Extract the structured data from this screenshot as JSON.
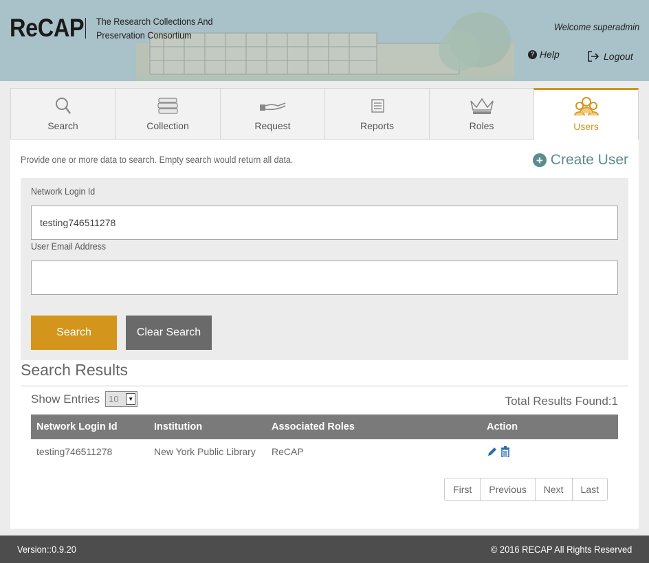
{
  "header": {
    "logo": "ReCAP",
    "tagline_line1": "The Research Collections And",
    "tagline_line2": "Preservation Consortium",
    "welcome": "Welcome superadmin",
    "help_label": "Help",
    "logout_label": "Logout"
  },
  "tabs": [
    {
      "label": "Search",
      "icon": "search-icon"
    },
    {
      "label": "Collection",
      "icon": "books-icon"
    },
    {
      "label": "Request",
      "icon": "hand-book-icon"
    },
    {
      "label": "Reports",
      "icon": "report-icon"
    },
    {
      "label": "Roles",
      "icon": "crown-icon"
    },
    {
      "label": "Users",
      "icon": "users-icon",
      "active": true
    }
  ],
  "main": {
    "hint": "Provide one or more data to search. Empty search would return all data.",
    "create_user": "Create User",
    "network_login_label": "Network Login Id",
    "network_login_value": "testing746511278",
    "email_label": "User Email Address",
    "email_value": "",
    "search_button": "Search",
    "clear_button": "Clear Search"
  },
  "results": {
    "title": "Search Results",
    "show_entries_label": "Show Entries",
    "entries_value": "10",
    "total_label": "Total Results Found:1",
    "columns": [
      "Network Login Id",
      "Institution",
      "Associated Roles",
      "Action"
    ],
    "rows": [
      {
        "login": "testing746511278",
        "institution": "New York Public Library",
        "roles": "ReCAP"
      }
    ],
    "pager": [
      "First",
      "Previous",
      "Next",
      "Last"
    ]
  },
  "footer": {
    "version": "Version::0.9.20",
    "copyright": "© 2016 RECAP All Rights Reserved"
  },
  "colors": {
    "accent": "#d4951d",
    "header_bg": "#a9c1c8",
    "teal": "#5b8b8e",
    "action_blue": "#2a6db3"
  }
}
